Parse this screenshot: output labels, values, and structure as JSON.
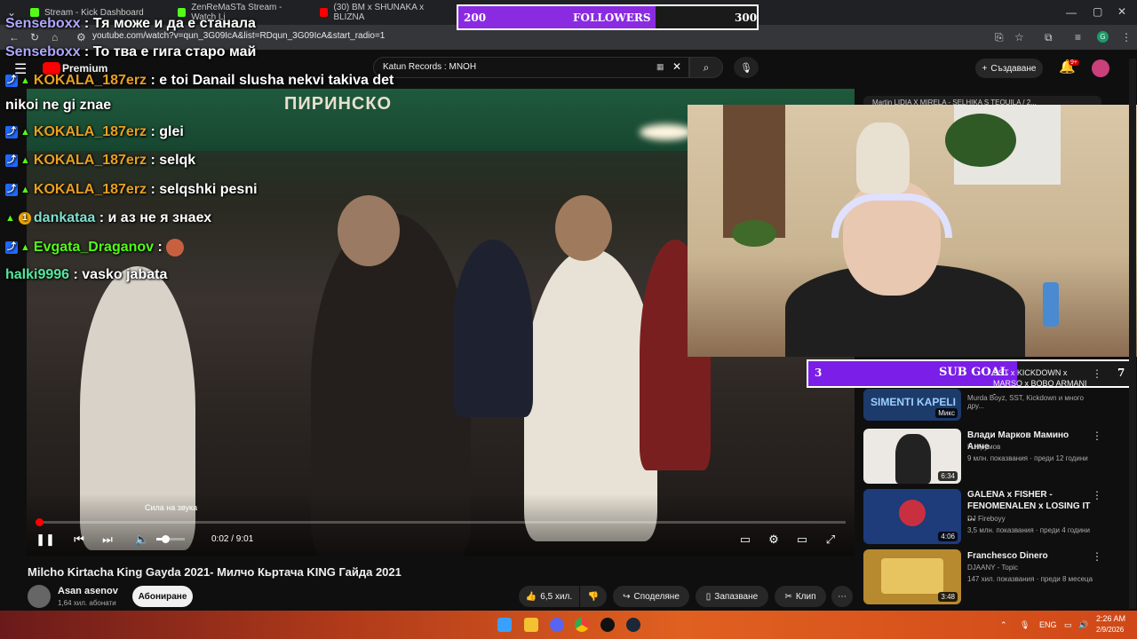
{
  "browser": {
    "tabs": [
      {
        "label": "Stream - Kick Dashboard",
        "color": "#53fc18"
      },
      {
        "label": "ZenReMaSTa Stream - Watch Li",
        "color": "#53fc18"
      },
      {
        "label": "(30) BM x SHUNAKA x BLIZNA",
        "color": "#ff0000"
      }
    ],
    "url": "youtube.com/watch?v=qun_3G09IcA&list=RDqun_3G09IcA&start_radio=1"
  },
  "youtube": {
    "logo_label": "Premium",
    "search_value": "Katun Records : MNOH",
    "create_label": "Създаване",
    "notif_count": "9+",
    "video": {
      "title": "Milcho Kirtacha King Gayda 2021- Милчо Кьртача KING Гайда 2021",
      "time": "0:02 / 9:01",
      "progress": 0.004,
      "volume": 0.3,
      "volume_tooltip": "Сила на звука",
      "watermark": "ПИРИНСКО"
    },
    "channel": {
      "name": "Asan asenov",
      "subs": "1,64 хил. абонати",
      "subscribe_label": "Абониране"
    },
    "actions": {
      "likes": "6,5 хил.",
      "share": "Споделяне",
      "save": "Запазване",
      "clip": "Клип"
    },
    "sidebar": [
      {
        "title": "SST x KICKDOWN x MARSO x BOBO ARMANI -",
        "meta1": "Murda Boyz, SST, Kickdown и много дру...",
        "meta2": "",
        "duration": "Микс",
        "thumb": "#1c3a6a"
      },
      {
        "title": "Влади Марков Мамино Анче",
        "meta1": "Н. Крумов",
        "meta2": "9 млн. показвания · преди 12 години",
        "duration": "6:34",
        "thumb": "#ece8e4"
      },
      {
        "title": "GALENA x FISHER - FENOMENALEN x LOSING IT ...",
        "meta1": "DJ Fireboyy",
        "meta2": "3,5 млн. показвания · преди 4 години",
        "duration": "4:06",
        "thumb": "#1e3b7a"
      },
      {
        "title": "Franchesco Dinero",
        "meta1": "DJAANY - Topic",
        "meta2": "147 хил. показвания · преди 8 месеца",
        "duration": "3:48",
        "thumb": "#b88a30"
      }
    ],
    "sidebar_top_text": "Mаrtin LIDIA X MIRELA - SELHIKA S TEQUILA / 2..."
  },
  "chat": [
    {
      "user": "Senseboxx",
      "text": "Тя може и да е станала",
      "color": "#b0a8ff",
      "badges": []
    },
    {
      "user": "Senseboxx",
      "text": "То тва е гига старо май",
      "color": "#b0a8ff",
      "badges": []
    },
    {
      "user": "KOKALA_187erz",
      "text": "e toi Danail slusha nekvi takiva det",
      "color": "#e8a020",
      "badges": [
        "x",
        "sub"
      ]
    },
    {
      "user": "",
      "text": "nikoi ne gi znae",
      "color": "#ffffff",
      "badges": []
    },
    {
      "user": "KOKALA_187erz",
      "text": "glei",
      "color": "#e8a020",
      "badges": [
        "x",
        "sub"
      ]
    },
    {
      "user": "KOKALA_187erz",
      "text": "selqk",
      "color": "#e8a020",
      "badges": [
        "x",
        "sub"
      ]
    },
    {
      "user": "KOKALA_187erz",
      "text": "selqshki pesni",
      "color": "#e8a020",
      "badges": [
        "x",
        "sub"
      ]
    },
    {
      "user": "dankataa",
      "text": "и аз не я знаех",
      "color": "#7ee0d0",
      "badges": [
        "sub",
        "1"
      ]
    },
    {
      "user": "Evgata_Draganov",
      "text": "",
      "color": "#53fc18",
      "badges": [
        "x",
        "sub"
      ]
    },
    {
      "user": "halki9996",
      "text": "vasko jabata",
      "color": "#53e8a0",
      "badges": []
    }
  ],
  "goals": {
    "followers": {
      "label": "FOLLOWERS",
      "start": "200",
      "end": "300",
      "fraction": 0.66
    },
    "subs": {
      "label": "SUB GOAL",
      "start": "3",
      "end": "7",
      "fraction": 0.65
    }
  },
  "taskbar": {
    "lang": "ENG",
    "time": "2:26 AM",
    "date": "2/9/2026"
  },
  "colors": {
    "accent": "#ff0000",
    "kick": "#53fc18",
    "goal_fill": "#7b1ee8"
  }
}
